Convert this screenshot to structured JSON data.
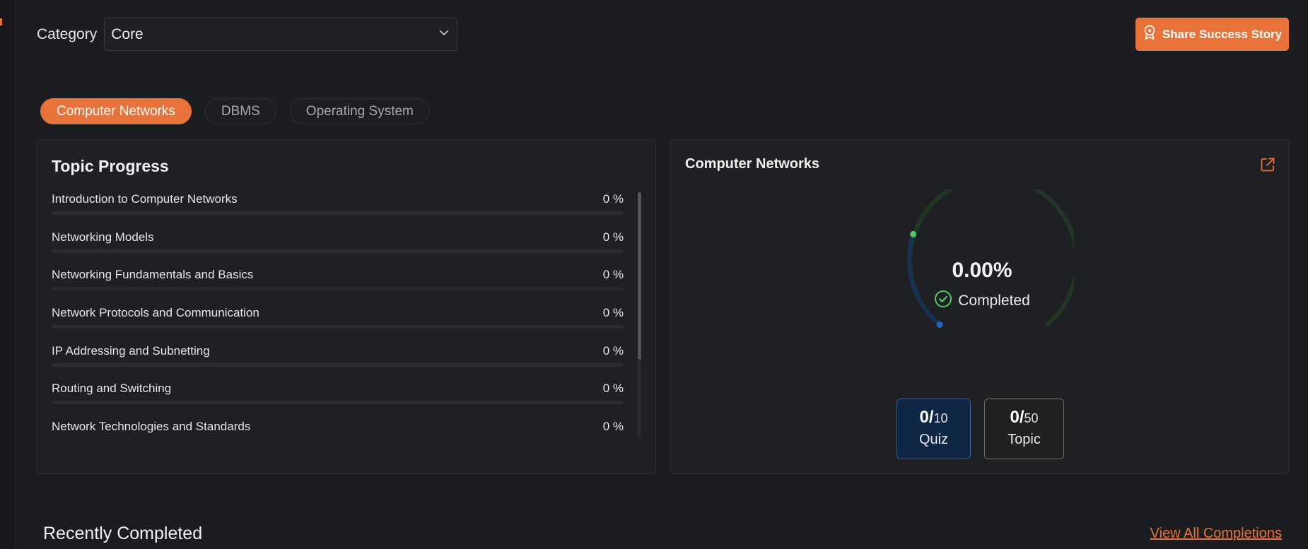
{
  "category": {
    "label": "Category",
    "value": "Core"
  },
  "share_button": {
    "label": "Share Success Story"
  },
  "tabs": [
    {
      "label": "Computer Networks",
      "active": true
    },
    {
      "label": "DBMS",
      "active": false
    },
    {
      "label": "Operating System",
      "active": false
    }
  ],
  "topic_progress": {
    "title": "Topic Progress",
    "topics": [
      {
        "name": "Introduction to Computer Networks",
        "percent": "0 %",
        "progress": 0
      },
      {
        "name": "Networking Models",
        "percent": "0 %",
        "progress": 0
      },
      {
        "name": "Networking Fundamentals and Basics",
        "percent": "0 %",
        "progress": 0
      },
      {
        "name": "Network Protocols and Communication",
        "percent": "0 %",
        "progress": 0
      },
      {
        "name": "IP Addressing and Subnetting",
        "percent": "0 %",
        "progress": 0
      },
      {
        "name": "Routing and Switching",
        "percent": "0 %",
        "progress": 0
      },
      {
        "name": "Network Technologies and Standards",
        "percent": "0 %",
        "progress": 0
      }
    ]
  },
  "course_summary": {
    "title": "Computer Networks",
    "percent": "0.00%",
    "status": "Completed",
    "quiz": {
      "done": "0/",
      "total": "10",
      "label": "Quiz"
    },
    "topic": {
      "done": "0/",
      "total": "50",
      "label": "Topic"
    }
  },
  "recent": {
    "title": "Recently Completed",
    "view_all": "View All Completions"
  },
  "colors": {
    "accent": "#e8733a",
    "background": "#1c1d20",
    "panel": "#1f2023",
    "gauge_green": "#4ccb63",
    "gauge_blue": "#1f63c7"
  },
  "icons": {
    "share": "award-badge-icon",
    "external": "external-link-icon",
    "dropdown": "chevron-down-icon",
    "status": "check-circle-icon"
  }
}
